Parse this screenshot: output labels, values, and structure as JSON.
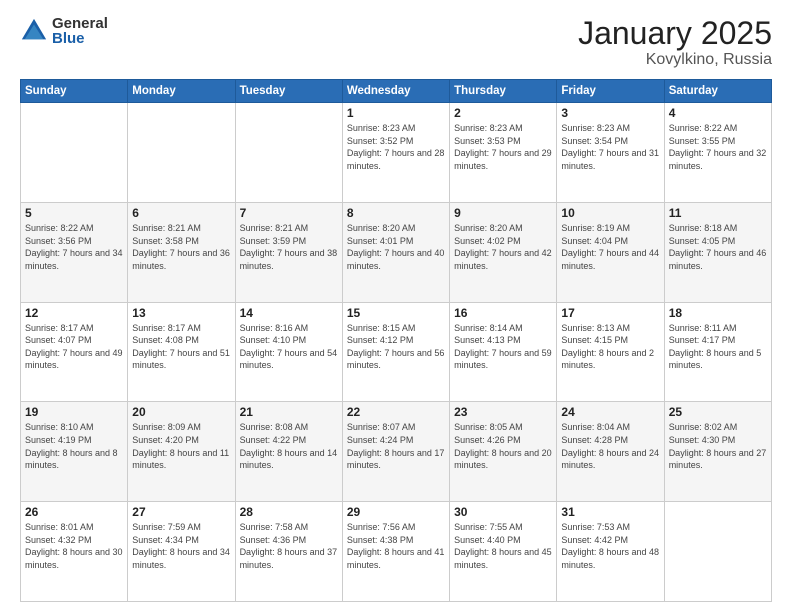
{
  "logo": {
    "general": "General",
    "blue": "Blue"
  },
  "title": "January 2025",
  "subtitle": "Kovylkino, Russia",
  "days_of_week": [
    "Sunday",
    "Monday",
    "Tuesday",
    "Wednesday",
    "Thursday",
    "Friday",
    "Saturday"
  ],
  "weeks": [
    [
      {
        "day": "",
        "sunrise": "",
        "sunset": "",
        "daylight": ""
      },
      {
        "day": "",
        "sunrise": "",
        "sunset": "",
        "daylight": ""
      },
      {
        "day": "",
        "sunrise": "",
        "sunset": "",
        "daylight": ""
      },
      {
        "day": "1",
        "sunrise": "Sunrise: 8:23 AM",
        "sunset": "Sunset: 3:52 PM",
        "daylight": "Daylight: 7 hours and 28 minutes."
      },
      {
        "day": "2",
        "sunrise": "Sunrise: 8:23 AM",
        "sunset": "Sunset: 3:53 PM",
        "daylight": "Daylight: 7 hours and 29 minutes."
      },
      {
        "day": "3",
        "sunrise": "Sunrise: 8:23 AM",
        "sunset": "Sunset: 3:54 PM",
        "daylight": "Daylight: 7 hours and 31 minutes."
      },
      {
        "day": "4",
        "sunrise": "Sunrise: 8:22 AM",
        "sunset": "Sunset: 3:55 PM",
        "daylight": "Daylight: 7 hours and 32 minutes."
      }
    ],
    [
      {
        "day": "5",
        "sunrise": "Sunrise: 8:22 AM",
        "sunset": "Sunset: 3:56 PM",
        "daylight": "Daylight: 7 hours and 34 minutes."
      },
      {
        "day": "6",
        "sunrise": "Sunrise: 8:21 AM",
        "sunset": "Sunset: 3:58 PM",
        "daylight": "Daylight: 7 hours and 36 minutes."
      },
      {
        "day": "7",
        "sunrise": "Sunrise: 8:21 AM",
        "sunset": "Sunset: 3:59 PM",
        "daylight": "Daylight: 7 hours and 38 minutes."
      },
      {
        "day": "8",
        "sunrise": "Sunrise: 8:20 AM",
        "sunset": "Sunset: 4:01 PM",
        "daylight": "Daylight: 7 hours and 40 minutes."
      },
      {
        "day": "9",
        "sunrise": "Sunrise: 8:20 AM",
        "sunset": "Sunset: 4:02 PM",
        "daylight": "Daylight: 7 hours and 42 minutes."
      },
      {
        "day": "10",
        "sunrise": "Sunrise: 8:19 AM",
        "sunset": "Sunset: 4:04 PM",
        "daylight": "Daylight: 7 hours and 44 minutes."
      },
      {
        "day": "11",
        "sunrise": "Sunrise: 8:18 AM",
        "sunset": "Sunset: 4:05 PM",
        "daylight": "Daylight: 7 hours and 46 minutes."
      }
    ],
    [
      {
        "day": "12",
        "sunrise": "Sunrise: 8:17 AM",
        "sunset": "Sunset: 4:07 PM",
        "daylight": "Daylight: 7 hours and 49 minutes."
      },
      {
        "day": "13",
        "sunrise": "Sunrise: 8:17 AM",
        "sunset": "Sunset: 4:08 PM",
        "daylight": "Daylight: 7 hours and 51 minutes."
      },
      {
        "day": "14",
        "sunrise": "Sunrise: 8:16 AM",
        "sunset": "Sunset: 4:10 PM",
        "daylight": "Daylight: 7 hours and 54 minutes."
      },
      {
        "day": "15",
        "sunrise": "Sunrise: 8:15 AM",
        "sunset": "Sunset: 4:12 PM",
        "daylight": "Daylight: 7 hours and 56 minutes."
      },
      {
        "day": "16",
        "sunrise": "Sunrise: 8:14 AM",
        "sunset": "Sunset: 4:13 PM",
        "daylight": "Daylight: 7 hours and 59 minutes."
      },
      {
        "day": "17",
        "sunrise": "Sunrise: 8:13 AM",
        "sunset": "Sunset: 4:15 PM",
        "daylight": "Daylight: 8 hours and 2 minutes."
      },
      {
        "day": "18",
        "sunrise": "Sunrise: 8:11 AM",
        "sunset": "Sunset: 4:17 PM",
        "daylight": "Daylight: 8 hours and 5 minutes."
      }
    ],
    [
      {
        "day": "19",
        "sunrise": "Sunrise: 8:10 AM",
        "sunset": "Sunset: 4:19 PM",
        "daylight": "Daylight: 8 hours and 8 minutes."
      },
      {
        "day": "20",
        "sunrise": "Sunrise: 8:09 AM",
        "sunset": "Sunset: 4:20 PM",
        "daylight": "Daylight: 8 hours and 11 minutes."
      },
      {
        "day": "21",
        "sunrise": "Sunrise: 8:08 AM",
        "sunset": "Sunset: 4:22 PM",
        "daylight": "Daylight: 8 hours and 14 minutes."
      },
      {
        "day": "22",
        "sunrise": "Sunrise: 8:07 AM",
        "sunset": "Sunset: 4:24 PM",
        "daylight": "Daylight: 8 hours and 17 minutes."
      },
      {
        "day": "23",
        "sunrise": "Sunrise: 8:05 AM",
        "sunset": "Sunset: 4:26 PM",
        "daylight": "Daylight: 8 hours and 20 minutes."
      },
      {
        "day": "24",
        "sunrise": "Sunrise: 8:04 AM",
        "sunset": "Sunset: 4:28 PM",
        "daylight": "Daylight: 8 hours and 24 minutes."
      },
      {
        "day": "25",
        "sunrise": "Sunrise: 8:02 AM",
        "sunset": "Sunset: 4:30 PM",
        "daylight": "Daylight: 8 hours and 27 minutes."
      }
    ],
    [
      {
        "day": "26",
        "sunrise": "Sunrise: 8:01 AM",
        "sunset": "Sunset: 4:32 PM",
        "daylight": "Daylight: 8 hours and 30 minutes."
      },
      {
        "day": "27",
        "sunrise": "Sunrise: 7:59 AM",
        "sunset": "Sunset: 4:34 PM",
        "daylight": "Daylight: 8 hours and 34 minutes."
      },
      {
        "day": "28",
        "sunrise": "Sunrise: 7:58 AM",
        "sunset": "Sunset: 4:36 PM",
        "daylight": "Daylight: 8 hours and 37 minutes."
      },
      {
        "day": "29",
        "sunrise": "Sunrise: 7:56 AM",
        "sunset": "Sunset: 4:38 PM",
        "daylight": "Daylight: 8 hours and 41 minutes."
      },
      {
        "day": "30",
        "sunrise": "Sunrise: 7:55 AM",
        "sunset": "Sunset: 4:40 PM",
        "daylight": "Daylight: 8 hours and 45 minutes."
      },
      {
        "day": "31",
        "sunrise": "Sunrise: 7:53 AM",
        "sunset": "Sunset: 4:42 PM",
        "daylight": "Daylight: 8 hours and 48 minutes."
      },
      {
        "day": "",
        "sunrise": "",
        "sunset": "",
        "daylight": ""
      }
    ]
  ]
}
